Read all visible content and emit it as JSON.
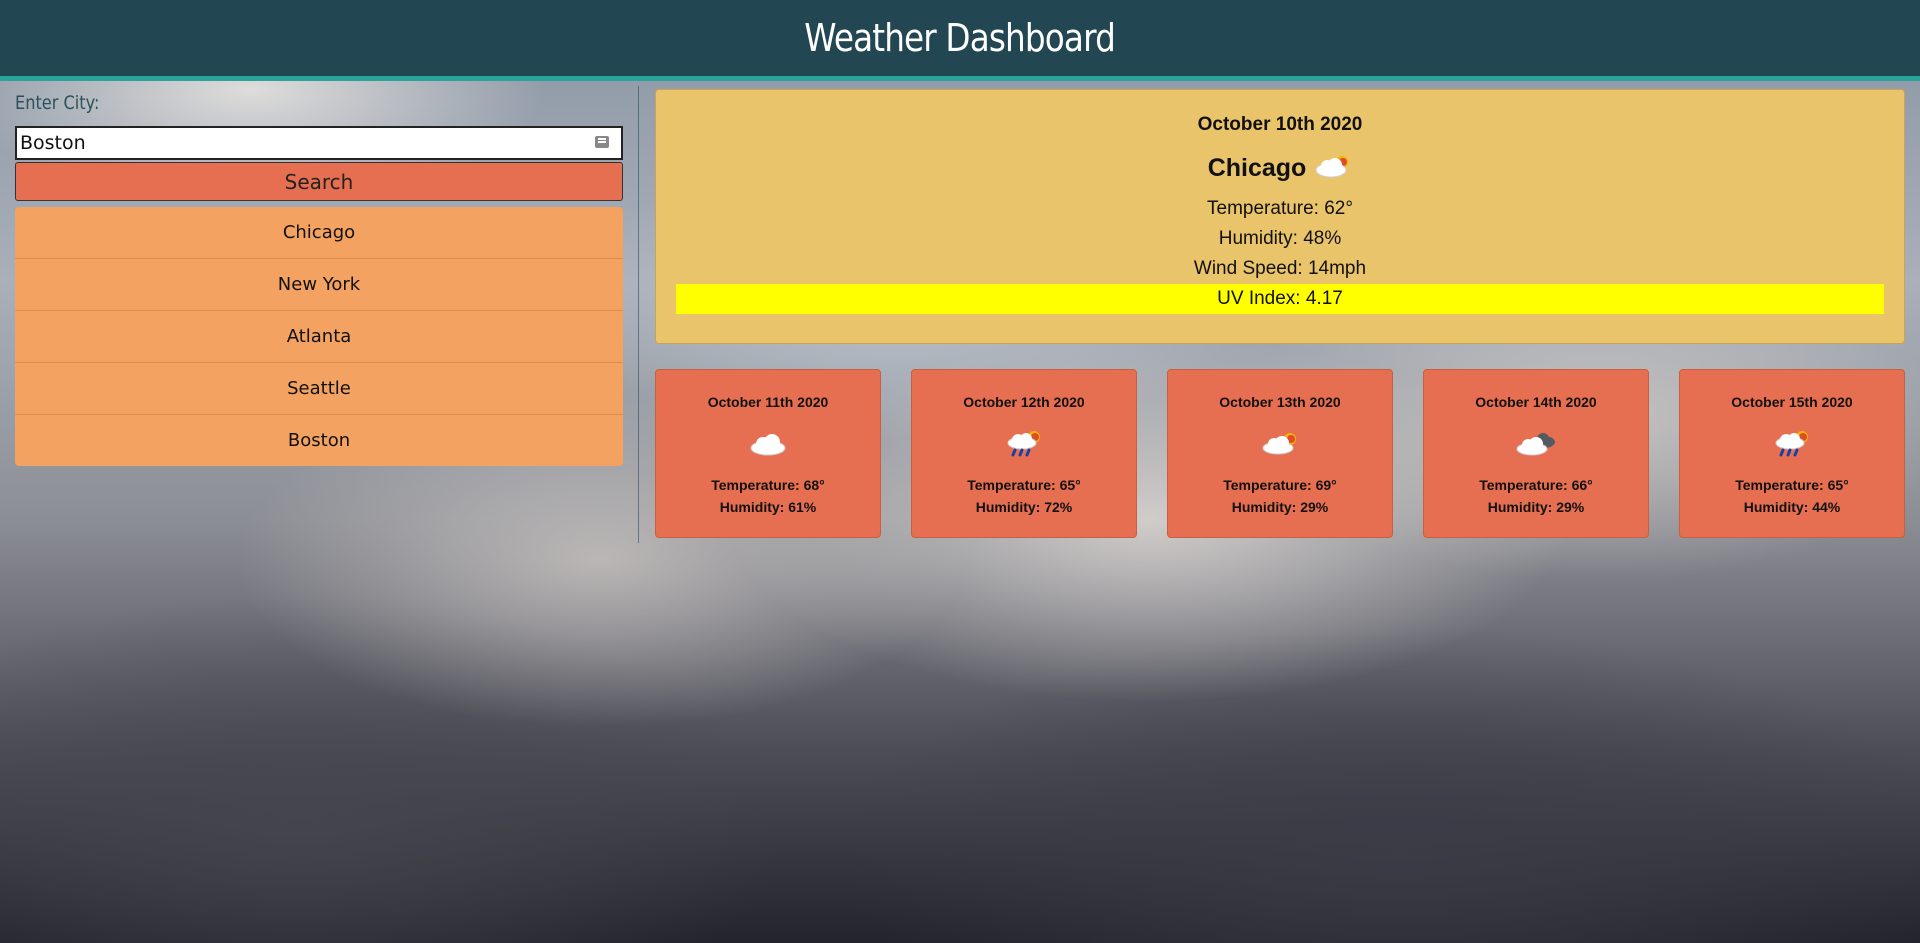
{
  "header": {
    "title": "Weather Dashboard"
  },
  "search": {
    "label": "Enter City:",
    "input_value": "Boston",
    "button_label": "Search"
  },
  "history": [
    "Chicago",
    "New York",
    "Atlanta",
    "Seattle",
    "Boston"
  ],
  "current": {
    "date": "October 10th 2020",
    "city": "Chicago",
    "icon": "cloud-sun-icon",
    "temperature": "Temperature: 62°",
    "humidity": "Humidity: 48%",
    "wind": "Wind Speed: 14mph",
    "uv": "UV Index: 4.17"
  },
  "forecast": [
    {
      "date": "October 11th 2020",
      "icon": "cloud-icon",
      "temperature": "Temperature: 68°",
      "humidity": "Humidity: 61%"
    },
    {
      "date": "October 12th 2020",
      "icon": "rain-sun-icon",
      "temperature": "Temperature: 65°",
      "humidity": "Humidity: 72%"
    },
    {
      "date": "October 13th 2020",
      "icon": "cloud-sun-icon",
      "temperature": "Temperature: 69°",
      "humidity": "Humidity: 29%"
    },
    {
      "date": "October 14th 2020",
      "icon": "broken-clouds-icon",
      "temperature": "Temperature: 66°",
      "humidity": "Humidity: 29%"
    },
    {
      "date": "October 15th 2020",
      "icon": "rain-sun-icon",
      "temperature": "Temperature: 65°",
      "humidity": "Humidity: 44%"
    }
  ],
  "colors": {
    "header_bg": "#234653",
    "header_border": "#2aa39a",
    "search_button": "#e76f51",
    "history_item": "#f4a261",
    "current_panel": "#e9c46a",
    "uv_highlight": "#ffff00",
    "forecast_card": "#e76f51"
  }
}
